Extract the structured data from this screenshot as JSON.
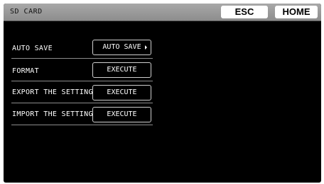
{
  "header": {
    "title": "SD CARD",
    "esc_label": "ESC",
    "home_label": "HOME"
  },
  "rows": [
    {
      "label": "AUTO SAVE",
      "button": "AUTO SAVE",
      "icon": "chevron-right-icon"
    },
    {
      "label": "FORMAT",
      "button": "EXECUTE"
    },
    {
      "label": "EXPORT THE SETTINGS",
      "button": "EXECUTE"
    },
    {
      "label": "IMPORT THE SETTINGS",
      "button": "EXECUTE"
    }
  ],
  "colors": {
    "screen_bg": "#000000",
    "header_bg": "#9a9a9a",
    "button_bg": "#ffffff",
    "text": "#ffffff"
  }
}
